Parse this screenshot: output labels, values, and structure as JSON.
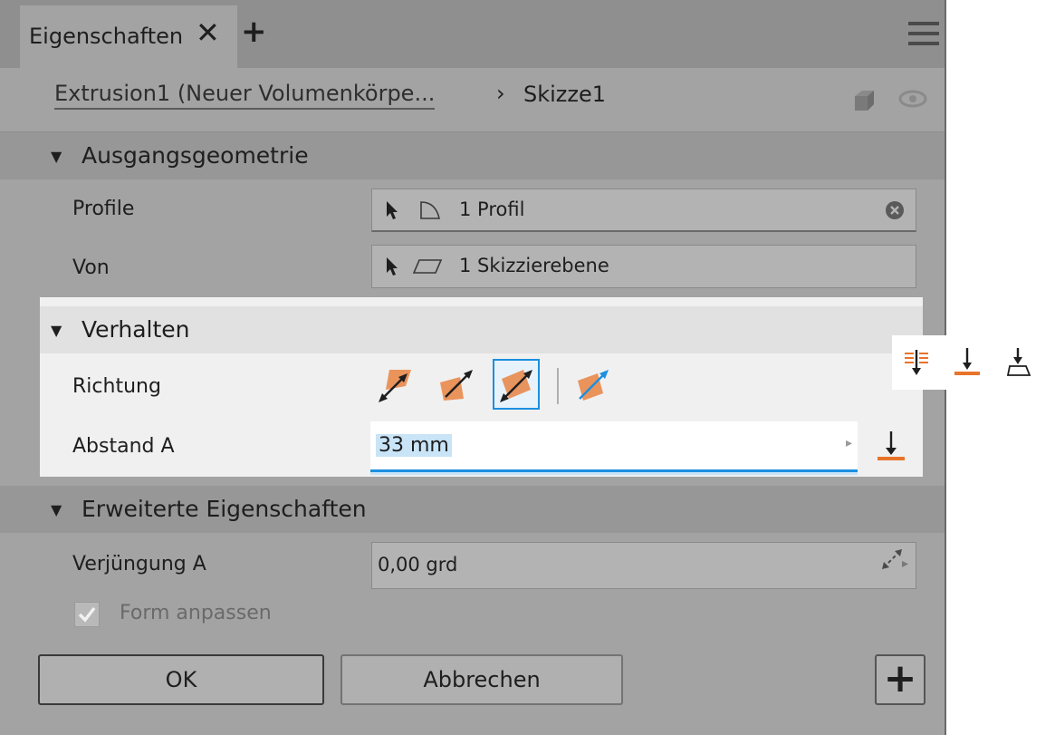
{
  "tab": {
    "label": "Eigenschaften",
    "close": "✕",
    "add": "+"
  },
  "breadcrumb": {
    "parent": "Extrusion1 (Neuer Volumenkörpe...",
    "separator": "›",
    "current": "Skizze1"
  },
  "sections": {
    "ausgangsgeometrie": {
      "title": "Ausgangsgeometrie",
      "profile_label": "Profile",
      "profile_value": "1 Profil",
      "von_label": "Von",
      "von_value": "1 Skizzierebene"
    },
    "verhalten": {
      "title": "Verhalten",
      "richtung_label": "Richtung",
      "abstand_label": "Abstand A",
      "abstand_value": "33 mm"
    },
    "erweitert": {
      "title": "Erweiterte Eigenschaften",
      "verjuengung_label": "Verjüngung A",
      "verjuengung_value": "0,00 grd",
      "form_anpassen_label": "Form anpassen",
      "form_anpassen_checked": true
    }
  },
  "buttons": {
    "ok": "OK",
    "cancel": "Abbrechen",
    "add": "+"
  },
  "colors": {
    "accent": "#1c8fe0",
    "orange": "#e8742a",
    "panel": "#a3a3a3"
  }
}
